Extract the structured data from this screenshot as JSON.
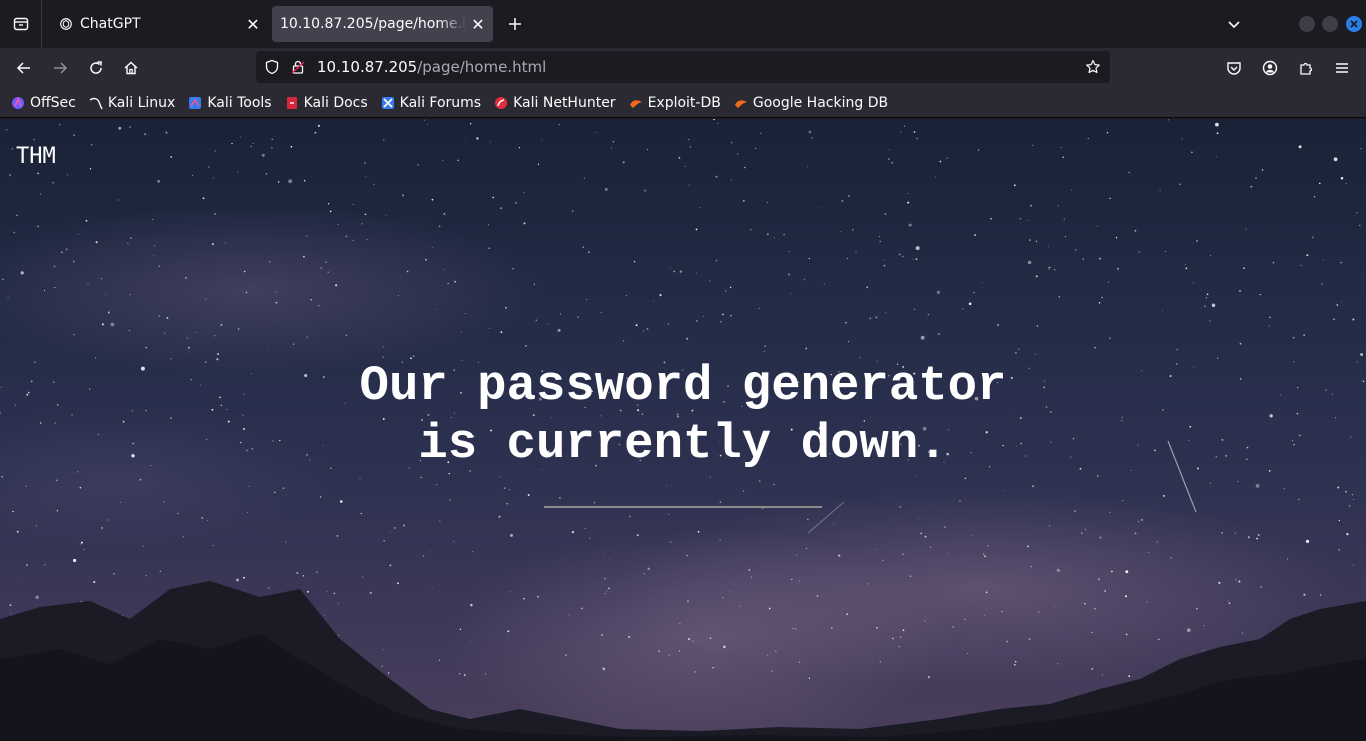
{
  "browser": {
    "tabs": [
      {
        "title": "ChatGPT",
        "icon": "chatgpt-icon"
      },
      {
        "title": "10.10.87.205/page/home.html",
        "icon": "none",
        "active": true
      }
    ],
    "url": {
      "host": "10.10.87.205",
      "path": "/page/home.html"
    },
    "bookmarks": [
      {
        "label": "OffSec",
        "icon": "offsec-icon"
      },
      {
        "label": "Kali Linux",
        "icon": "kali-linux-icon"
      },
      {
        "label": "Kali Tools",
        "icon": "kali-tools-icon"
      },
      {
        "label": "Kali Docs",
        "icon": "kali-docs-icon"
      },
      {
        "label": "Kali Forums",
        "icon": "kali-forums-icon"
      },
      {
        "label": "Kali NetHunter",
        "icon": "kali-nethunter-icon"
      },
      {
        "label": "Exploit-DB",
        "icon": "exploit-db-icon"
      },
      {
        "label": "Google Hacking DB",
        "icon": "google-hacking-db-icon"
      }
    ],
    "colors": {
      "chrome_dark": "#1c1b22",
      "toolbar": "#2b2a33",
      "accent": "#2b7de9"
    }
  },
  "page": {
    "logo": "THM",
    "headline": {
      "line1": "Our password generator",
      "line2": "is currently down."
    }
  }
}
